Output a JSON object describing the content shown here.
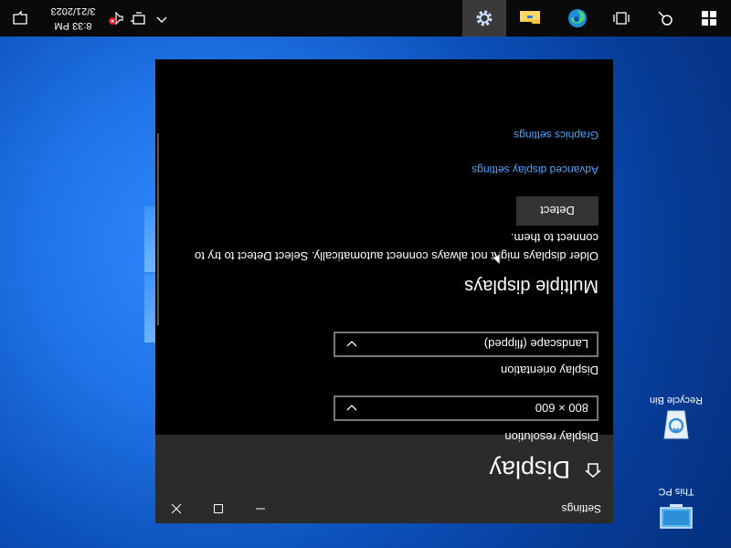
{
  "desktop": {
    "icons": [
      {
        "label": "This PC"
      },
      {
        "label": "Recycle Bin"
      }
    ]
  },
  "window": {
    "title": "Settings",
    "page_title": "Display",
    "resolution": {
      "label": "Display resolution",
      "value": "800 × 600"
    },
    "orientation": {
      "label": "Display orientation",
      "value": "Landscape (flipped)"
    },
    "multiple_displays": {
      "title": "Multiple displays",
      "description": "Older displays might not always connect automatically. Select Detect to try to connect to them.",
      "detect_label": "Detect"
    },
    "links": {
      "advanced": "Advanced display settings",
      "graphics": "Graphics settings"
    }
  },
  "taskbar": {
    "time": "8:33 PM",
    "date": "3/21/2023"
  },
  "colors": {
    "accent": "#4ea6ff",
    "window_bg": "#000000",
    "header_bg": "#2b2b2b"
  }
}
